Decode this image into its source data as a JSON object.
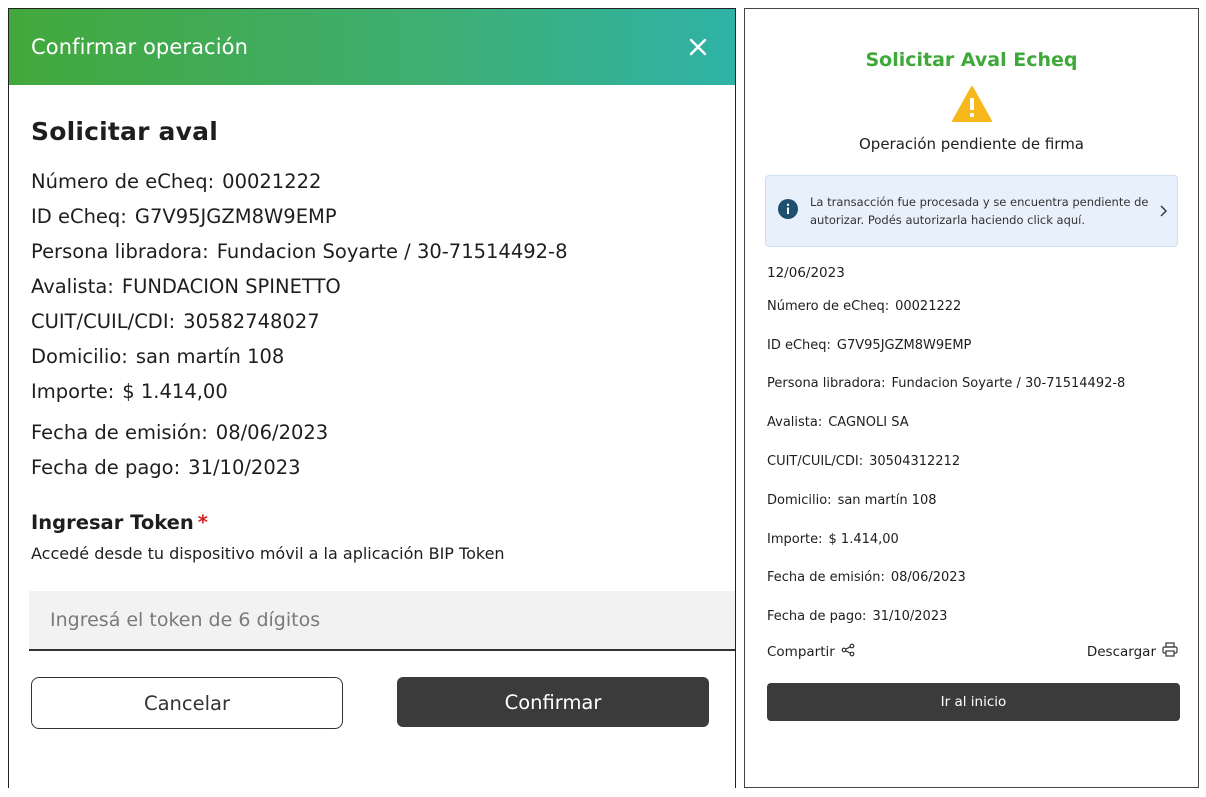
{
  "modal": {
    "header_title": "Confirmar operación",
    "heading": "Solicitar aval",
    "fields": [
      {
        "label": "Número de eCheq:",
        "value": "00021222"
      },
      {
        "label": "ID eCheq:",
        "value": "G7V95JGZM8W9EMP"
      },
      {
        "label": "Persona libradora:",
        "value": "Fundacion Soyarte / 30-71514492-8"
      },
      {
        "label": "Avalista:",
        "value": "FUNDACION SPINETTO"
      },
      {
        "label": "CUIT/CUIL/CDI:",
        "value": "30582748027"
      },
      {
        "label": "Domicilio:",
        "value": "san martín 108"
      },
      {
        "label": "Importe:",
        "value": "$ 1.414,00"
      }
    ],
    "dates": [
      {
        "label": "Fecha de emisión:",
        "value": "08/06/2023"
      },
      {
        "label": "Fecha de pago:",
        "value": "31/10/2023"
      }
    ],
    "token_label": "Ingresar Token",
    "token_required_mark": "*",
    "token_help": "Accedé desde tu dispositivo móvil a la aplicación BIP Token",
    "token_placeholder": "Ingresá el token de 6 dígitos",
    "token_value": "",
    "cancel_label": "Cancelar",
    "confirm_label": "Confirmar"
  },
  "receipt": {
    "title": "Solicitar Aval Echeq",
    "status": "Operación pendiente de firma",
    "info_text": "La transacción fue procesada y se encuentra pendiente de autorizar. Podés autorizarla haciendo click aquí.",
    "date": "12/06/2023",
    "fields": [
      {
        "label": "Número de eCheq:",
        "value": "00021222"
      },
      {
        "label": "ID eCheq:",
        "value": "G7V95JGZM8W9EMP"
      },
      {
        "label": "Persona libradora:",
        "value": "Fundacion Soyarte / 30-71514492-8"
      },
      {
        "label": "Avalista:",
        "value": "CAGNOLI SA"
      },
      {
        "label": "CUIT/CUIL/CDI:",
        "value": "30504312212"
      },
      {
        "label": "Domicilio:",
        "value": "san martín 108"
      },
      {
        "label": "Importe:",
        "value": "$ 1.414,00"
      },
      {
        "label": "Fecha de emisión:",
        "value": "08/06/2023"
      },
      {
        "label": "Fecha de pago:",
        "value": "31/10/2023"
      }
    ],
    "share_label": "Compartir",
    "download_label": "Descargar",
    "home_button_label": "Ir al inicio"
  },
  "colors": {
    "brand_green": "#3ea839",
    "header_gradient_end": "#2fb3a7",
    "warning": "#f6b81b",
    "info_icon": "#1f4f6e",
    "dark_button": "#3b3b3b",
    "required": "#d32222"
  },
  "icons": [
    "close-icon",
    "warning-icon",
    "info-icon",
    "chevron-right-icon",
    "share-icon",
    "print-icon"
  ]
}
